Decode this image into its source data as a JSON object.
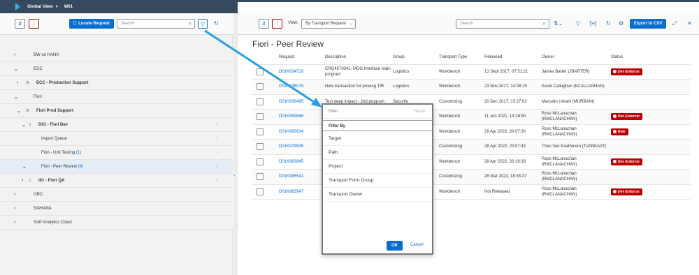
{
  "shell": {
    "title": "Global View",
    "caret": "▾",
    "system": "W01",
    "icons": [
      "search-icon",
      "bell-icon",
      "filter-icon",
      "help-icon",
      "avatar"
    ]
  },
  "left": {
    "expand_all_icon": "expand-all-icon",
    "collapse_icon": "collapse-icon",
    "locate_button": "Locate Request",
    "search_placeholder": "Search",
    "tree": [
      {
        "label": "BW on HANA",
        "chevron": "›",
        "level": 0
      },
      {
        "label": "ECC",
        "chevron": "⌄",
        "level": 0
      },
      {
        "label": "ECC - Production Support",
        "chevron": "›",
        "level": 1,
        "bold": true,
        "icon": "layers-icon"
      },
      {
        "label": "Fiori",
        "chevron": "⌄",
        "level": 0
      },
      {
        "label": "Fiori Prod Support",
        "chevron": "⌄",
        "level": 1,
        "bold": true,
        "icon": "layers-icon"
      },
      {
        "label": "D01 - Fiori Dev",
        "chevron": "⌄",
        "level": 2,
        "bold": true,
        "icon": "device-icon",
        "nav": true
      },
      {
        "label": "Import Queue",
        "level": 3,
        "nav": true
      },
      {
        "label": "Fiori - Unit Testing",
        "count": "(1)",
        "level": 3,
        "nav": true
      },
      {
        "label": "Fiori - Peer Review",
        "count": "(9)",
        "chevron": "⌄",
        "level": 3,
        "nav": true,
        "selected": true
      },
      {
        "label": "I01 - Fiori QA",
        "chevron": "›",
        "level": 2,
        "bold": true,
        "icon": "device-icon",
        "nav": true
      },
      {
        "label": "GRC",
        "chevron": "›",
        "level": 0
      },
      {
        "label": "S/4HANA",
        "chevron": "›",
        "level": 0
      },
      {
        "label": "SAP Analytics Cloud",
        "chevron": "›",
        "level": 0
      }
    ]
  },
  "right": {
    "view_label": "View:",
    "view_value": "By Transport Request",
    "search_placeholder": "Search",
    "export_button": "Export to CSV",
    "heading": "Fiori - Peer Review",
    "columns": [
      "Request",
      "Description",
      "Group",
      "Transport Type",
      "Released",
      "Owner",
      "Status"
    ],
    "rows": [
      {
        "request": "D01K934718",
        "description": "CRQ4570341: MDG Interface main program",
        "group": "Logistics",
        "type": "Workbench",
        "released": "13 Sept 2017, 07:51:21",
        "owner": "James Barter (JBARTER)",
        "status": "Dev Enforcer"
      },
      {
        "request": "D01K936079",
        "description": "New transaction for proving TIR",
        "group": "Logistics",
        "type": "Workbench",
        "released": "23 Nov 2017, 14:08:19",
        "owner": "Kevin Callaghan (KCALLAGHAN)",
        "status": ""
      },
      {
        "request": "D01K936495",
        "description": "Test deep impact - 2nd program",
        "group": "Security",
        "type": "Customizing",
        "released": "20 Dec 2017, 13:27:02",
        "owner": "Marcello Urbani (MURBANI)",
        "status": ""
      },
      {
        "request": "D01K959886",
        "description": "",
        "group": "",
        "type": "Workbench",
        "released": "11 Jun 2021, 13:28:50",
        "owner": "Ross McLanachan (RMCLANACHAN)",
        "status": "Dev Enforcer"
      },
      {
        "request": "D01K983934",
        "description": "",
        "group": "",
        "type": "Workbench",
        "released": "28 Apr 2022, 20:07:30",
        "owner": "Ross McLanachan (RMCLANACHAN)",
        "status": "Risk"
      },
      {
        "request": "D01K979936",
        "description": "",
        "group": "",
        "type": "Customizing",
        "released": "28 Apr 2022, 20:07:43",
        "owner": "Theo Van Kaathoven (TVANKAAT)",
        "status": ""
      },
      {
        "request": "D01K983945",
        "description": "",
        "group": "",
        "type": "Workbench",
        "released": "28 Apr 2022, 20:16:39",
        "owner": "Ross McLanachan (RMCLANACHAN)",
        "status": "Dev Enforcer"
      },
      {
        "request": "D01K985541",
        "description": "",
        "group": "",
        "type": "Customizing",
        "released": "28 Mar 2023, 18:38:37",
        "owner": "Ross McLanachan (RMCLANACHAN)",
        "status": ""
      },
      {
        "request": "D01K983947",
        "description": "",
        "group": "",
        "type": "Workbench",
        "released": "Not Released",
        "owner": "Ross McLanachan (RMCLANACHAN)",
        "status": "Dev Enforcer"
      }
    ]
  },
  "filter_popover": {
    "placeholder": "Filter",
    "reset": "Reset",
    "section": "Filter By",
    "items": [
      "Target",
      "Path",
      "Project",
      "Transport Form Group",
      "Transport Owner"
    ],
    "ok": "OK",
    "cancel": "Cancel"
  },
  "colors": {
    "shell": "#354a5f",
    "accent": "#0a6ed1",
    "negative": "#bb0000",
    "annotation_arrow": "#2a9fe0"
  }
}
